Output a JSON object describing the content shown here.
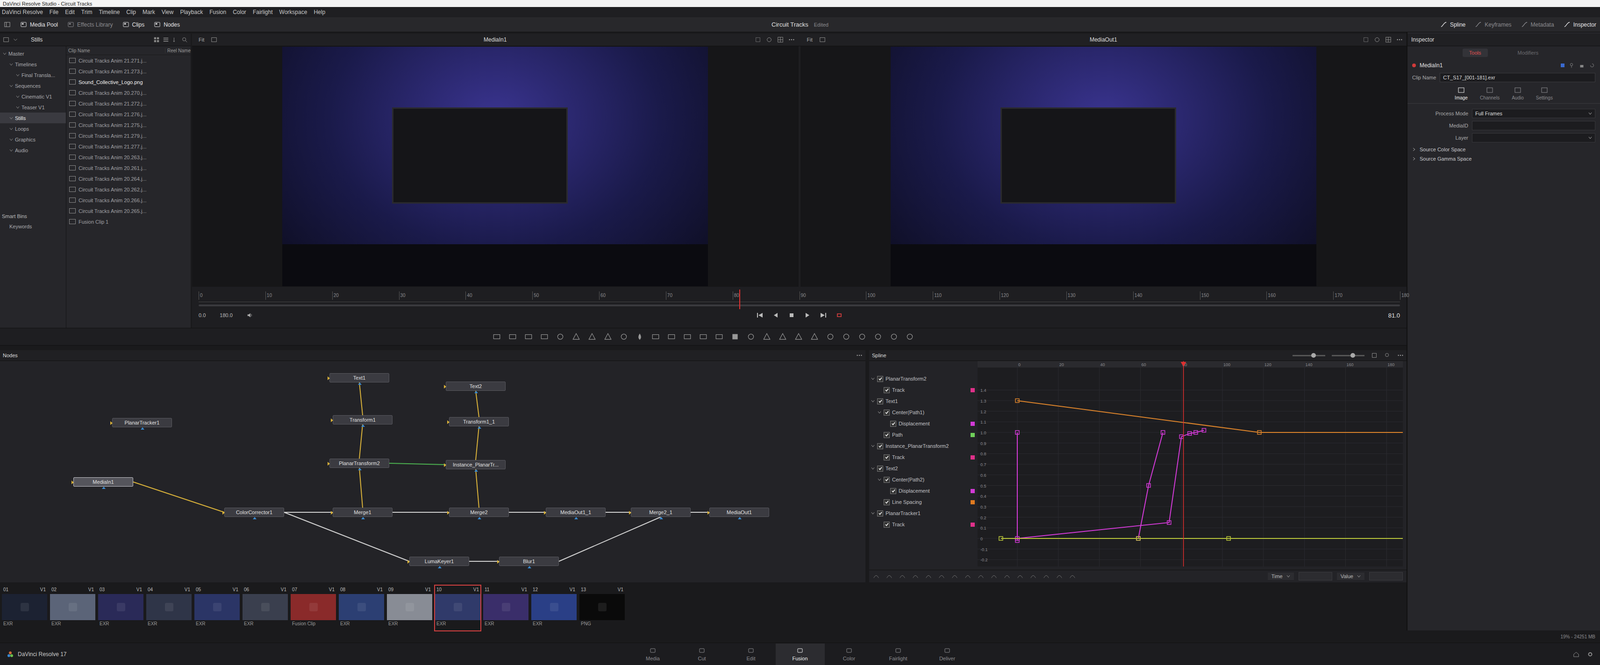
{
  "window": {
    "title": "DaVinci Resolve Studio - Circuit Tracks"
  },
  "menu": [
    "DaVinci Resolve",
    "File",
    "Edit",
    "Trim",
    "Timeline",
    "Clip",
    "Mark",
    "View",
    "Playback",
    "Fusion",
    "Color",
    "Fairlight",
    "Workspace",
    "Help"
  ],
  "toolbar": {
    "left": [
      {
        "label": "Media Pool",
        "active": true
      },
      {
        "label": "Effects Library",
        "active": false
      },
      {
        "label": "Clips",
        "active": true
      },
      {
        "label": "Nodes",
        "active": true
      }
    ],
    "project": "Circuit Tracks",
    "status": "Edited",
    "right": [
      {
        "label": "Spline",
        "active": true
      },
      {
        "label": "Keyframes",
        "active": false
      },
      {
        "label": "Metadata",
        "active": false
      },
      {
        "label": "Inspector",
        "active": true
      }
    ]
  },
  "bins": {
    "header": "Stills",
    "items": [
      {
        "label": "Master",
        "depth": 0,
        "selected": false
      },
      {
        "label": "Timelines",
        "depth": 1,
        "selected": false
      },
      {
        "label": "Final Transla...",
        "depth": 2,
        "selected": false
      },
      {
        "label": "Sequences",
        "depth": 1,
        "selected": false
      },
      {
        "label": "Cinematic V1",
        "depth": 2,
        "selected": false
      },
      {
        "label": "Teaser V1",
        "depth": 2,
        "selected": false
      },
      {
        "label": "Stills",
        "depth": 1,
        "selected": true
      },
      {
        "label": "Loops",
        "depth": 1,
        "selected": false
      },
      {
        "label": "Graphics",
        "depth": 1,
        "selected": false
      },
      {
        "label": "Audio",
        "depth": 1,
        "selected": false
      }
    ],
    "smart_title": "Smart Bins",
    "smart_items": [
      "Keywords"
    ]
  },
  "media_pool": {
    "columns": [
      "Clip Name",
      "Reel Name"
    ],
    "items": [
      {
        "name": "Circuit Tracks Anim 21.271.j...",
        "selected": false
      },
      {
        "name": "Circuit Tracks Anim 21.273.j...",
        "selected": false
      },
      {
        "name": "Sound_Collective_Logo.png",
        "selected": true
      },
      {
        "name": "Circuit Tracks Anim 20.270.j...",
        "selected": false
      },
      {
        "name": "Circuit Tracks Anim 21.272.j...",
        "selected": false
      },
      {
        "name": "Circuit Tracks Anim 21.276.j...",
        "selected": false
      },
      {
        "name": "Circuit Tracks Anim 21.275.j...",
        "selected": false
      },
      {
        "name": "Circuit Tracks Anim 21.279.j...",
        "selected": false
      },
      {
        "name": "Circuit Tracks Anim 21.277.j...",
        "selected": false
      },
      {
        "name": "Circuit Tracks Anim 20.263.j...",
        "selected": false
      },
      {
        "name": "Circuit Tracks Anim 20.261.j...",
        "selected": false
      },
      {
        "name": "Circuit Tracks Anim 20.264.j...",
        "selected": false
      },
      {
        "name": "Circuit Tracks Anim 20.262.j...",
        "selected": false
      },
      {
        "name": "Circuit Tracks Anim 20.266.j...",
        "selected": false
      },
      {
        "name": "Circuit Tracks Anim 20.265.j...",
        "selected": false
      },
      {
        "name": "Fusion Clip 1",
        "selected": false
      }
    ]
  },
  "viewers": [
    {
      "title": "MediaIn1",
      "fit": "Fit"
    },
    {
      "title": "MediaOut1",
      "fit": "Fit"
    }
  ],
  "ruler": {
    "labels": [
      "0",
      "10",
      "20",
      "30",
      "40",
      "50",
      "60",
      "70",
      "80",
      "90",
      "100",
      "110",
      "120",
      "130",
      "140",
      "150",
      "160",
      "170",
      "180"
    ],
    "playhead": 81
  },
  "transport": {
    "start": "0.0",
    "end": "180.0",
    "current": "81.0"
  },
  "nodes": {
    "title": "Nodes",
    "items": [
      {
        "name": "Text1",
        "selected": false
      },
      {
        "name": "Text2",
        "selected": false
      },
      {
        "name": "PlanarTracker1",
        "selected": false
      },
      {
        "name": "Transform1",
        "selected": false
      },
      {
        "name": "Transform1_1",
        "selected": false
      },
      {
        "name": "PlanarTransform2",
        "selected": false
      },
      {
        "name": "Instance_PlanarTr...",
        "selected": false
      },
      {
        "name": "MediaIn1",
        "selected": true
      },
      {
        "name": "ColorCorrector1",
        "selected": false
      },
      {
        "name": "Merge1",
        "selected": false
      },
      {
        "name": "Merge2",
        "selected": false
      },
      {
        "name": "MediaOut1_1",
        "selected": false
      },
      {
        "name": "Merge2_1",
        "selected": false
      },
      {
        "name": "MediaOut1",
        "selected": false
      },
      {
        "name": "LumaKeyer1",
        "selected": false
      },
      {
        "name": "Blur1",
        "selected": false
      }
    ],
    "edges": [
      {
        "from": "MediaIn1",
        "to": "ColorCorrector1",
        "color": "#d8b13a"
      },
      {
        "from": "ColorCorrector1",
        "to": "Merge1",
        "color": "#d0d0d0"
      },
      {
        "from": "ColorCorrector1",
        "to": "LumaKeyer1",
        "color": "#d0d0d0"
      },
      {
        "from": "Text1",
        "to": "Transform1",
        "color": "#d8b13a"
      },
      {
        "from": "Transform1",
        "to": "PlanarTransform2",
        "color": "#d8b13a"
      },
      {
        "from": "PlanarTransform2",
        "to": "Merge1",
        "color": "#d8b13a"
      },
      {
        "from": "Text2",
        "to": "Transform1_1",
        "color": "#d8b13a"
      },
      {
        "from": "Transform1_1",
        "to": "Instance_PlanarTr...",
        "color": "#d8b13a"
      },
      {
        "from": "Instance_PlanarTr...",
        "to": "Merge2",
        "color": "#d8b13a"
      },
      {
        "from": "PlanarTransform2",
        "to": "Instance_PlanarTr...",
        "color": "#4caf50"
      },
      {
        "from": "Merge1",
        "to": "Merge2",
        "color": "#d0d0d0"
      },
      {
        "from": "Merge2",
        "to": "MediaOut1_1",
        "color": "#d0d0d0"
      },
      {
        "from": "MediaOut1_1",
        "to": "Merge2_1",
        "color": "#d0d0d0"
      },
      {
        "from": "Merge2_1",
        "to": "MediaOut1",
        "color": "#d0d0d0"
      },
      {
        "from": "LumaKeyer1",
        "to": "Blur1",
        "color": "#d0d0d0"
      },
      {
        "from": "Blur1",
        "to": "Merge2_1",
        "color": "#d0d0d0"
      }
    ]
  },
  "spline": {
    "title": "Spline",
    "tree": [
      {
        "label": "PlanarTransform2",
        "depth": 0,
        "checked": true,
        "expanded": true,
        "color": ""
      },
      {
        "label": "Track",
        "depth": 1,
        "checked": true,
        "expanded": false,
        "color": "#e0308a"
      },
      {
        "label": "Text1",
        "depth": 0,
        "checked": true,
        "expanded": true,
        "color": ""
      },
      {
        "label": "Center(Path1)",
        "depth": 1,
        "checked": true,
        "expanded": true,
        "color": ""
      },
      {
        "label": "Displacement",
        "depth": 2,
        "checked": true,
        "expanded": false,
        "color": "#d23ad6"
      },
      {
        "label": "Path",
        "depth": 1,
        "checked": true,
        "expanded": false,
        "color": "#6fd05a"
      },
      {
        "label": "Instance_PlanarTransform2",
        "depth": 0,
        "checked": true,
        "expanded": true,
        "color": ""
      },
      {
        "label": "Track",
        "depth": 1,
        "checked": true,
        "expanded": false,
        "color": "#e0308a"
      },
      {
        "label": "Text2",
        "depth": 0,
        "checked": true,
        "expanded": true,
        "color": ""
      },
      {
        "label": "Center(Path2)",
        "depth": 1,
        "checked": true,
        "expanded": true,
        "color": ""
      },
      {
        "label": "Displacement",
        "depth": 2,
        "checked": true,
        "expanded": false,
        "color": "#d23ad6"
      },
      {
        "label": "Line Spacing",
        "depth": 1,
        "checked": true,
        "expanded": false,
        "color": "#e07a20"
      },
      {
        "label": "PlanarTracker1",
        "depth": 0,
        "checked": true,
        "expanded": true,
        "color": ""
      },
      {
        "label": "Track",
        "depth": 1,
        "checked": true,
        "expanded": false,
        "color": "#e0308a"
      }
    ],
    "x_ticks": [
      "0",
      "20",
      "40",
      "60",
      "80",
      "100",
      "120",
      "140",
      "160",
      "180"
    ],
    "y_ticks": [
      "1.4",
      "1.3",
      "1.2",
      "1.1",
      "1.0",
      "0.9",
      "0.8",
      "0.7",
      "0.6",
      "0.5",
      "0.4",
      "0.3",
      "0.2",
      "0.1",
      "0",
      "-0.1",
      "-0.2"
    ],
    "curves": [
      {
        "color": "#d9822b",
        "points": [
          [
            0,
            1.3
          ],
          [
            118,
            1.0
          ],
          [
            189,
            1.0
          ]
        ]
      },
      {
        "color": "#d23ad6",
        "points": [
          [
            0,
            0
          ],
          [
            74,
            0.15
          ],
          [
            80,
            0.96
          ],
          [
            84,
            0.99
          ],
          [
            87,
            1.0
          ],
          [
            91,
            1.02
          ]
        ]
      },
      {
        "color": "#d23ad6",
        "points": [
          [
            59,
            0
          ],
          [
            64,
            0.5
          ],
          [
            71,
            1.0
          ]
        ]
      },
      {
        "color": "#d23ad6",
        "points": [
          [
            0,
            1.0
          ],
          [
            0,
            -0.02
          ]
        ]
      },
      {
        "color": "#b8c43a",
        "points": [
          [
            -8,
            0
          ],
          [
            59,
            0
          ],
          [
            103,
            0
          ],
          [
            189,
            0
          ]
        ]
      }
    ],
    "playhead": 81,
    "footer": [
      {
        "label": "Time",
        "value": ""
      },
      {
        "label": "Value",
        "value": ""
      }
    ]
  },
  "inspector": {
    "title": "Inspector",
    "tabs": [
      {
        "label": "Tools",
        "selected": true
      },
      {
        "label": "Modifiers",
        "selected": false
      }
    ],
    "node": "MediaIn1",
    "clip_name_label": "Clip Name",
    "clip_name": "CT_S17_[001-181].exr",
    "subtabs": [
      {
        "label": "Image",
        "selected": true
      },
      {
        "label": "Channels",
        "selected": false
      },
      {
        "label": "Audio",
        "selected": false
      },
      {
        "label": "Settings",
        "selected": false
      }
    ],
    "fields": [
      {
        "label": "Process Mode",
        "value": "Full Frames",
        "kind": "dropdown"
      },
      {
        "label": "MediaID",
        "value": "",
        "kind": "text"
      },
      {
        "label": "Layer",
        "value": "",
        "kind": "dropdown"
      }
    ],
    "sections": [
      {
        "label": "Source Color Space",
        "expanded": false
      },
      {
        "label": "Source Gamma Space",
        "expanded": false
      }
    ]
  },
  "clips": [
    {
      "number": "01",
      "track": "V1",
      "format": "EXR",
      "selected": false,
      "color": "#1c2232"
    },
    {
      "number": "02",
      "track": "V1",
      "format": "EXR",
      "selected": false,
      "color": "#5b6478"
    },
    {
      "number": "03",
      "track": "V1",
      "format": "EXR",
      "selected": false,
      "color": "#2a2a58"
    },
    {
      "number": "04",
      "track": "V1",
      "format": "EXR",
      "selected": false,
      "color": "#2f3548"
    },
    {
      "number": "05",
      "track": "V1",
      "format": "EXR",
      "selected": false,
      "color": "#2b3566"
    },
    {
      "number": "06",
      "track": "V1",
      "format": "EXR",
      "selected": false,
      "color": "#3a3f4e"
    },
    {
      "number": "07",
      "track": "V1",
      "format": "Fusion Clip",
      "selected": false,
      "color": "#8a2a2a"
    },
    {
      "number": "08",
      "track": "V1",
      "format": "EXR",
      "selected": false,
      "color": "#2c3f73"
    },
    {
      "number": "09",
      "track": "V1",
      "format": "EXR",
      "selected": false,
      "color": "#888c95"
    },
    {
      "number": "10",
      "track": "V1",
      "format": "EXR",
      "selected": true,
      "color": "#303a6a"
    },
    {
      "number": "11",
      "track": "V1",
      "format": "EXR",
      "selected": false,
      "color": "#3a2e6a"
    },
    {
      "number": "12",
      "track": "V1",
      "format": "EXR",
      "selected": false,
      "color": "#2a3f86"
    },
    {
      "number": "13",
      "track": "V1",
      "format": "PNG",
      "selected": false,
      "color": "#0a0a0a"
    }
  ],
  "pages": [
    {
      "label": "Media",
      "selected": false
    },
    {
      "label": "Cut",
      "selected": false
    },
    {
      "label": "Edit",
      "selected": false
    },
    {
      "label": "Fusion",
      "selected": true
    },
    {
      "label": "Color",
      "selected": false
    },
    {
      "label": "Fairlight",
      "selected": false
    },
    {
      "label": "Deliver",
      "selected": false
    }
  ],
  "app_name": "DaVinci Resolve 17",
  "memory": "19% - 24251 MB"
}
